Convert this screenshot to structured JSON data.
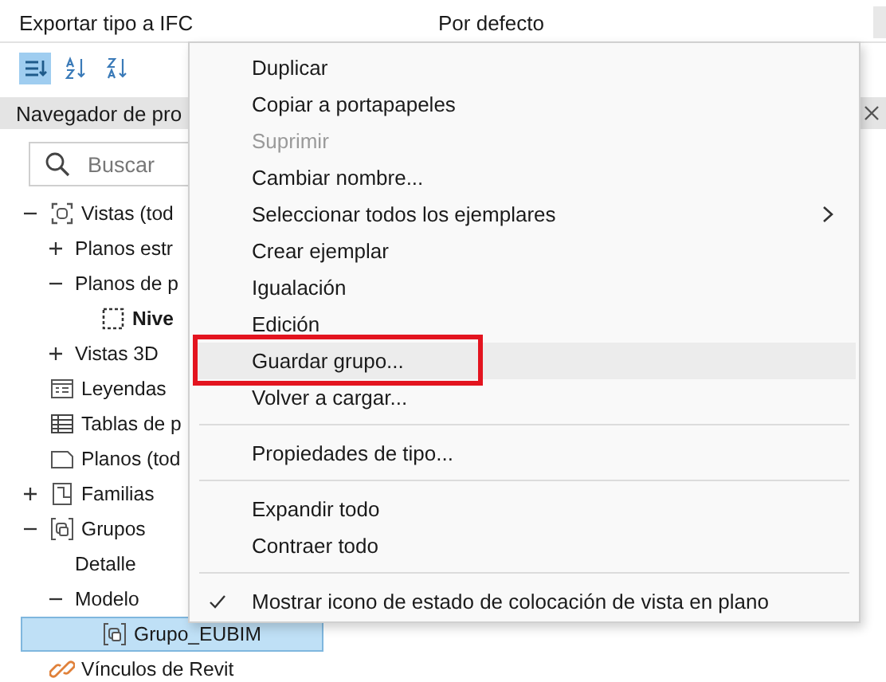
{
  "properties": {
    "label": "Exportar tipo a IFC",
    "value": "Por defecto"
  },
  "toolbar": [
    {
      "kind": "categorize",
      "selected": true
    },
    {
      "kind": "sort-asc",
      "selected": false
    },
    {
      "kind": "sort-desc",
      "selected": false
    }
  ],
  "browser": {
    "title": "Navegador de pro",
    "search": {
      "placeholder": "Buscar"
    },
    "tree": [
      {
        "label": "Vistas (tod",
        "kind": "view",
        "expanded": true,
        "selected": false,
        "children": [
          {
            "label": "Planos estr",
            "expanded": false,
            "selected": false
          },
          {
            "label": "Planos de p",
            "expanded": true,
            "selected": false,
            "children": [
              {
                "label": "Nive",
                "kind": "level",
                "selected": false,
                "bold": true
              }
            ]
          },
          {
            "label": "Vistas 3D",
            "expanded": false,
            "selected": false
          }
        ]
      },
      {
        "label": "Leyendas",
        "kind": "legend",
        "selected": false
      },
      {
        "label": "Tablas de p",
        "kind": "schedule",
        "selected": false
      },
      {
        "label": "Planos (tod",
        "kind": "sheet",
        "selected": false
      },
      {
        "label": "Familias",
        "kind": "family",
        "expanded": false,
        "selected": false
      },
      {
        "label": "Grupos",
        "kind": "group",
        "expanded": true,
        "selected": false,
        "children": [
          {
            "label": "Detalle",
            "selected": false
          },
          {
            "label": "Modelo",
            "expanded": true,
            "selected": false,
            "children": [
              {
                "label": "Grupo_EUBIM",
                "kind": "group",
                "selected": true
              }
            ]
          }
        ]
      },
      {
        "label": "Vínculos de Revit",
        "kind": "link",
        "selected": false
      }
    ]
  },
  "context_menu": [
    {
      "kind": "item",
      "label": "Duplicar",
      "disabled": false,
      "selected": false,
      "submenu": false,
      "checked": false,
      "outlined": false
    },
    {
      "kind": "item",
      "label": "Copiar a portapapeles",
      "disabled": false,
      "selected": false,
      "submenu": false,
      "checked": false,
      "outlined": false
    },
    {
      "kind": "item",
      "label": "Suprimir",
      "disabled": true,
      "selected": false,
      "submenu": false,
      "checked": false,
      "outlined": false
    },
    {
      "kind": "item",
      "label": "Cambiar nombre...",
      "disabled": false,
      "selected": false,
      "submenu": false,
      "checked": false,
      "outlined": false
    },
    {
      "kind": "item",
      "label": "Seleccionar todos los ejemplares",
      "disabled": false,
      "selected": false,
      "submenu": true,
      "checked": false,
      "outlined": false
    },
    {
      "kind": "item",
      "label": "Crear ejemplar",
      "disabled": false,
      "selected": false,
      "submenu": false,
      "checked": false,
      "outlined": false
    },
    {
      "kind": "item",
      "label": "Igualación",
      "disabled": false,
      "selected": false,
      "submenu": false,
      "checked": false,
      "outlined": false
    },
    {
      "kind": "item",
      "label": "Edición",
      "disabled": false,
      "selected": false,
      "submenu": false,
      "checked": false,
      "outlined": false
    },
    {
      "kind": "item",
      "label": "Guardar grupo...",
      "disabled": false,
      "selected": true,
      "submenu": false,
      "checked": false,
      "outlined": true
    },
    {
      "kind": "item",
      "label": "Volver a cargar...",
      "disabled": false,
      "selected": false,
      "submenu": false,
      "checked": false,
      "outlined": false
    },
    {
      "kind": "separator"
    },
    {
      "kind": "item",
      "label": "Propiedades de tipo...",
      "disabled": false,
      "selected": false,
      "submenu": false,
      "checked": false,
      "outlined": false
    },
    {
      "kind": "separator"
    },
    {
      "kind": "item",
      "label": "Expandir todo",
      "disabled": false,
      "selected": false,
      "submenu": false,
      "checked": false,
      "outlined": false
    },
    {
      "kind": "item",
      "label": "Contraer todo",
      "disabled": false,
      "selected": false,
      "submenu": false,
      "checked": false,
      "outlined": false
    },
    {
      "kind": "separator"
    },
    {
      "kind": "item",
      "label": "Mostrar icono de estado de colocación de vista en plano",
      "disabled": false,
      "selected": false,
      "submenu": false,
      "checked": true,
      "outlined": false
    }
  ]
}
